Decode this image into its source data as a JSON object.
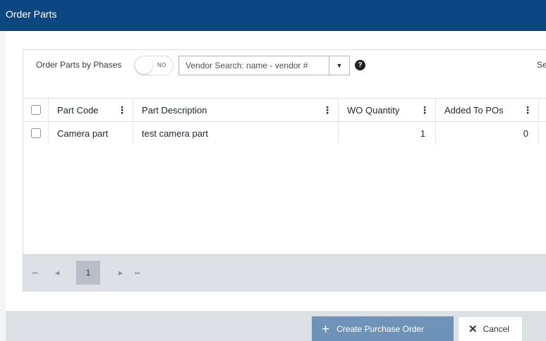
{
  "dialog": {
    "title": "Order Parts"
  },
  "toolbar": {
    "phase_label": "Order Parts by Phases",
    "phase_toggle_text": "NO",
    "vendor_placeholder": "Vendor Search: name - vendor #",
    "vendor_dropdown_glyph": "▼",
    "help_glyph": "?",
    "right_text_partial": "Se"
  },
  "grid": {
    "columns": [
      {
        "label": "Part Code",
        "menu": "⋮"
      },
      {
        "label": "Part Description",
        "menu": "⋮"
      },
      {
        "label": "WO Quantity",
        "menu": "⋮"
      },
      {
        "label": "Added To POs",
        "menu": "⋮"
      }
    ],
    "rows": [
      {
        "part_code": "Camera part",
        "part_description": "test camera part",
        "wo_quantity": "1",
        "added_to_pos": "0"
      }
    ]
  },
  "pager": {
    "first": "⏮",
    "prev": "◀",
    "current_page": "1",
    "next": "▶",
    "last": "⏭"
  },
  "footer": {
    "create_icon": "+",
    "create_label": "Create Purchase Order",
    "cancel_icon": "✕",
    "cancel_label": "Cancel"
  },
  "colors": {
    "title_bar": "#0c4680",
    "create_button": "#6f93b8",
    "footer_bg": "#dde0e5"
  },
  "icons": [
    "dropdown-arrow-icon",
    "help-icon",
    "kebab-menu-icon",
    "first-page-icon",
    "prev-page-icon",
    "next-page-icon",
    "last-page-icon",
    "plus-icon",
    "close-icon"
  ]
}
